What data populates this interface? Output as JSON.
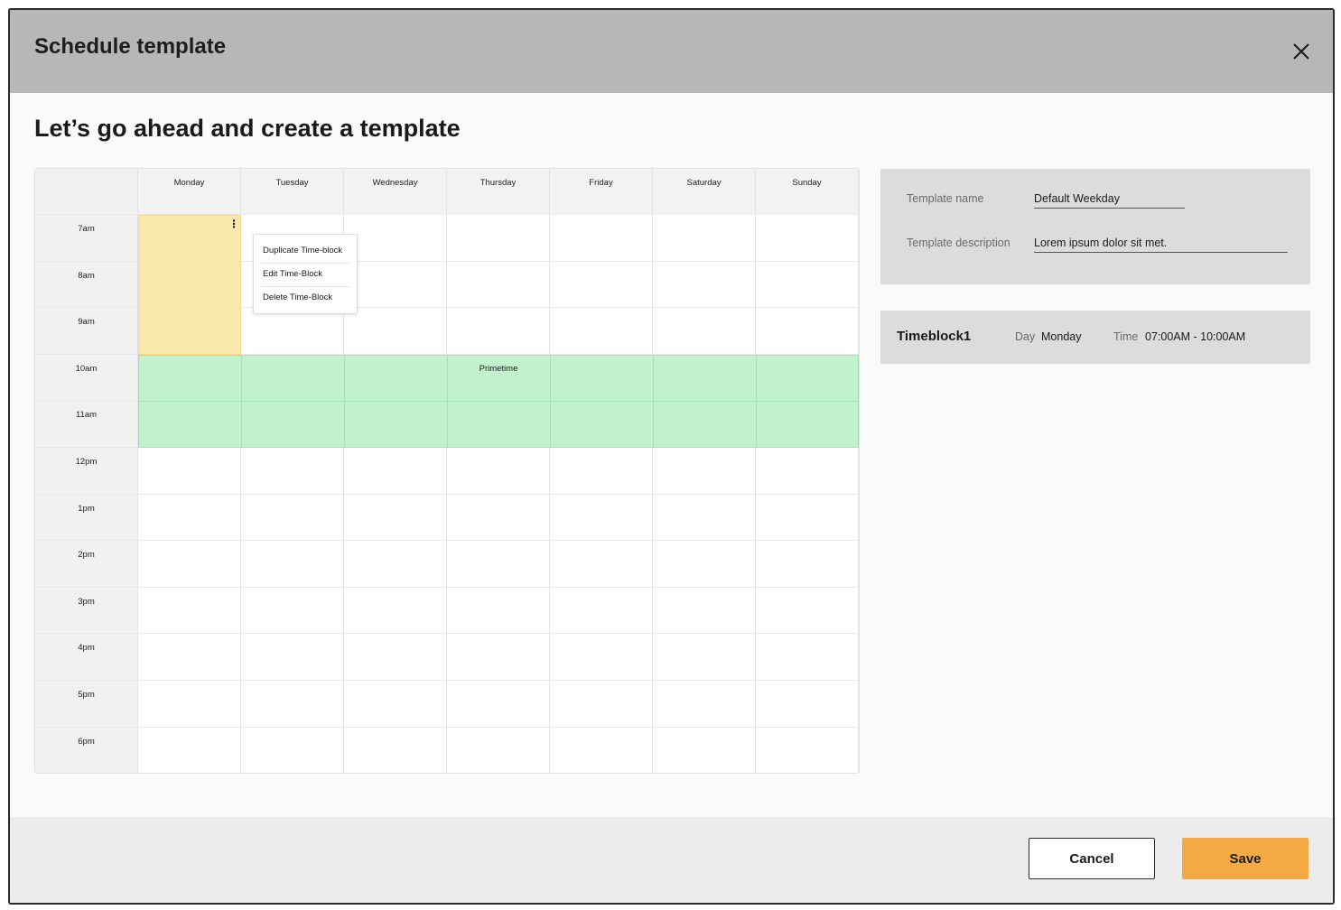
{
  "dialog": {
    "title": "Schedule template",
    "heading": "Let’s go ahead and create a template"
  },
  "calendar": {
    "days": [
      "Monday",
      "Tuesday",
      "Wednesday",
      "Thursday",
      "Friday",
      "Saturday",
      "Sunday"
    ],
    "hours": [
      "7am",
      "8am",
      "9am",
      "10am",
      "11am",
      "12pm",
      "1pm",
      "2pm",
      "3pm",
      "4pm",
      "5pm",
      "6pm"
    ],
    "blocks": [
      {
        "label": "",
        "color": "#fbe8ad",
        "day": "Monday",
        "start": "7am",
        "end": "10am"
      },
      {
        "label": "Primetime",
        "color": "#c1f2cb",
        "day": "Monday-Sunday",
        "start": "10am",
        "end": "12pm"
      }
    ],
    "context_menu": {
      "items": [
        "Duplicate Time-block",
        "Edit Time-Block",
        "Delete Time-Block"
      ]
    }
  },
  "form": {
    "name_label": "Template name",
    "name_value": "Default Weekday",
    "description_label": "Template description",
    "description_value": "Lorem ipsum dolor sit met."
  },
  "timeblock": {
    "name": "Timeblock1",
    "day_label": "Day",
    "day_value": "Monday",
    "time_label": "Time",
    "time_value": "07:00AM - 10:00AM"
  },
  "footer": {
    "cancel_label": "Cancel",
    "save_label": "Save"
  },
  "colors": {
    "header_bg": "#b7b7b7",
    "save_accent": "#f3aa45",
    "block_yellow": "#fbe8ad",
    "block_green": "#c1f2cb"
  }
}
